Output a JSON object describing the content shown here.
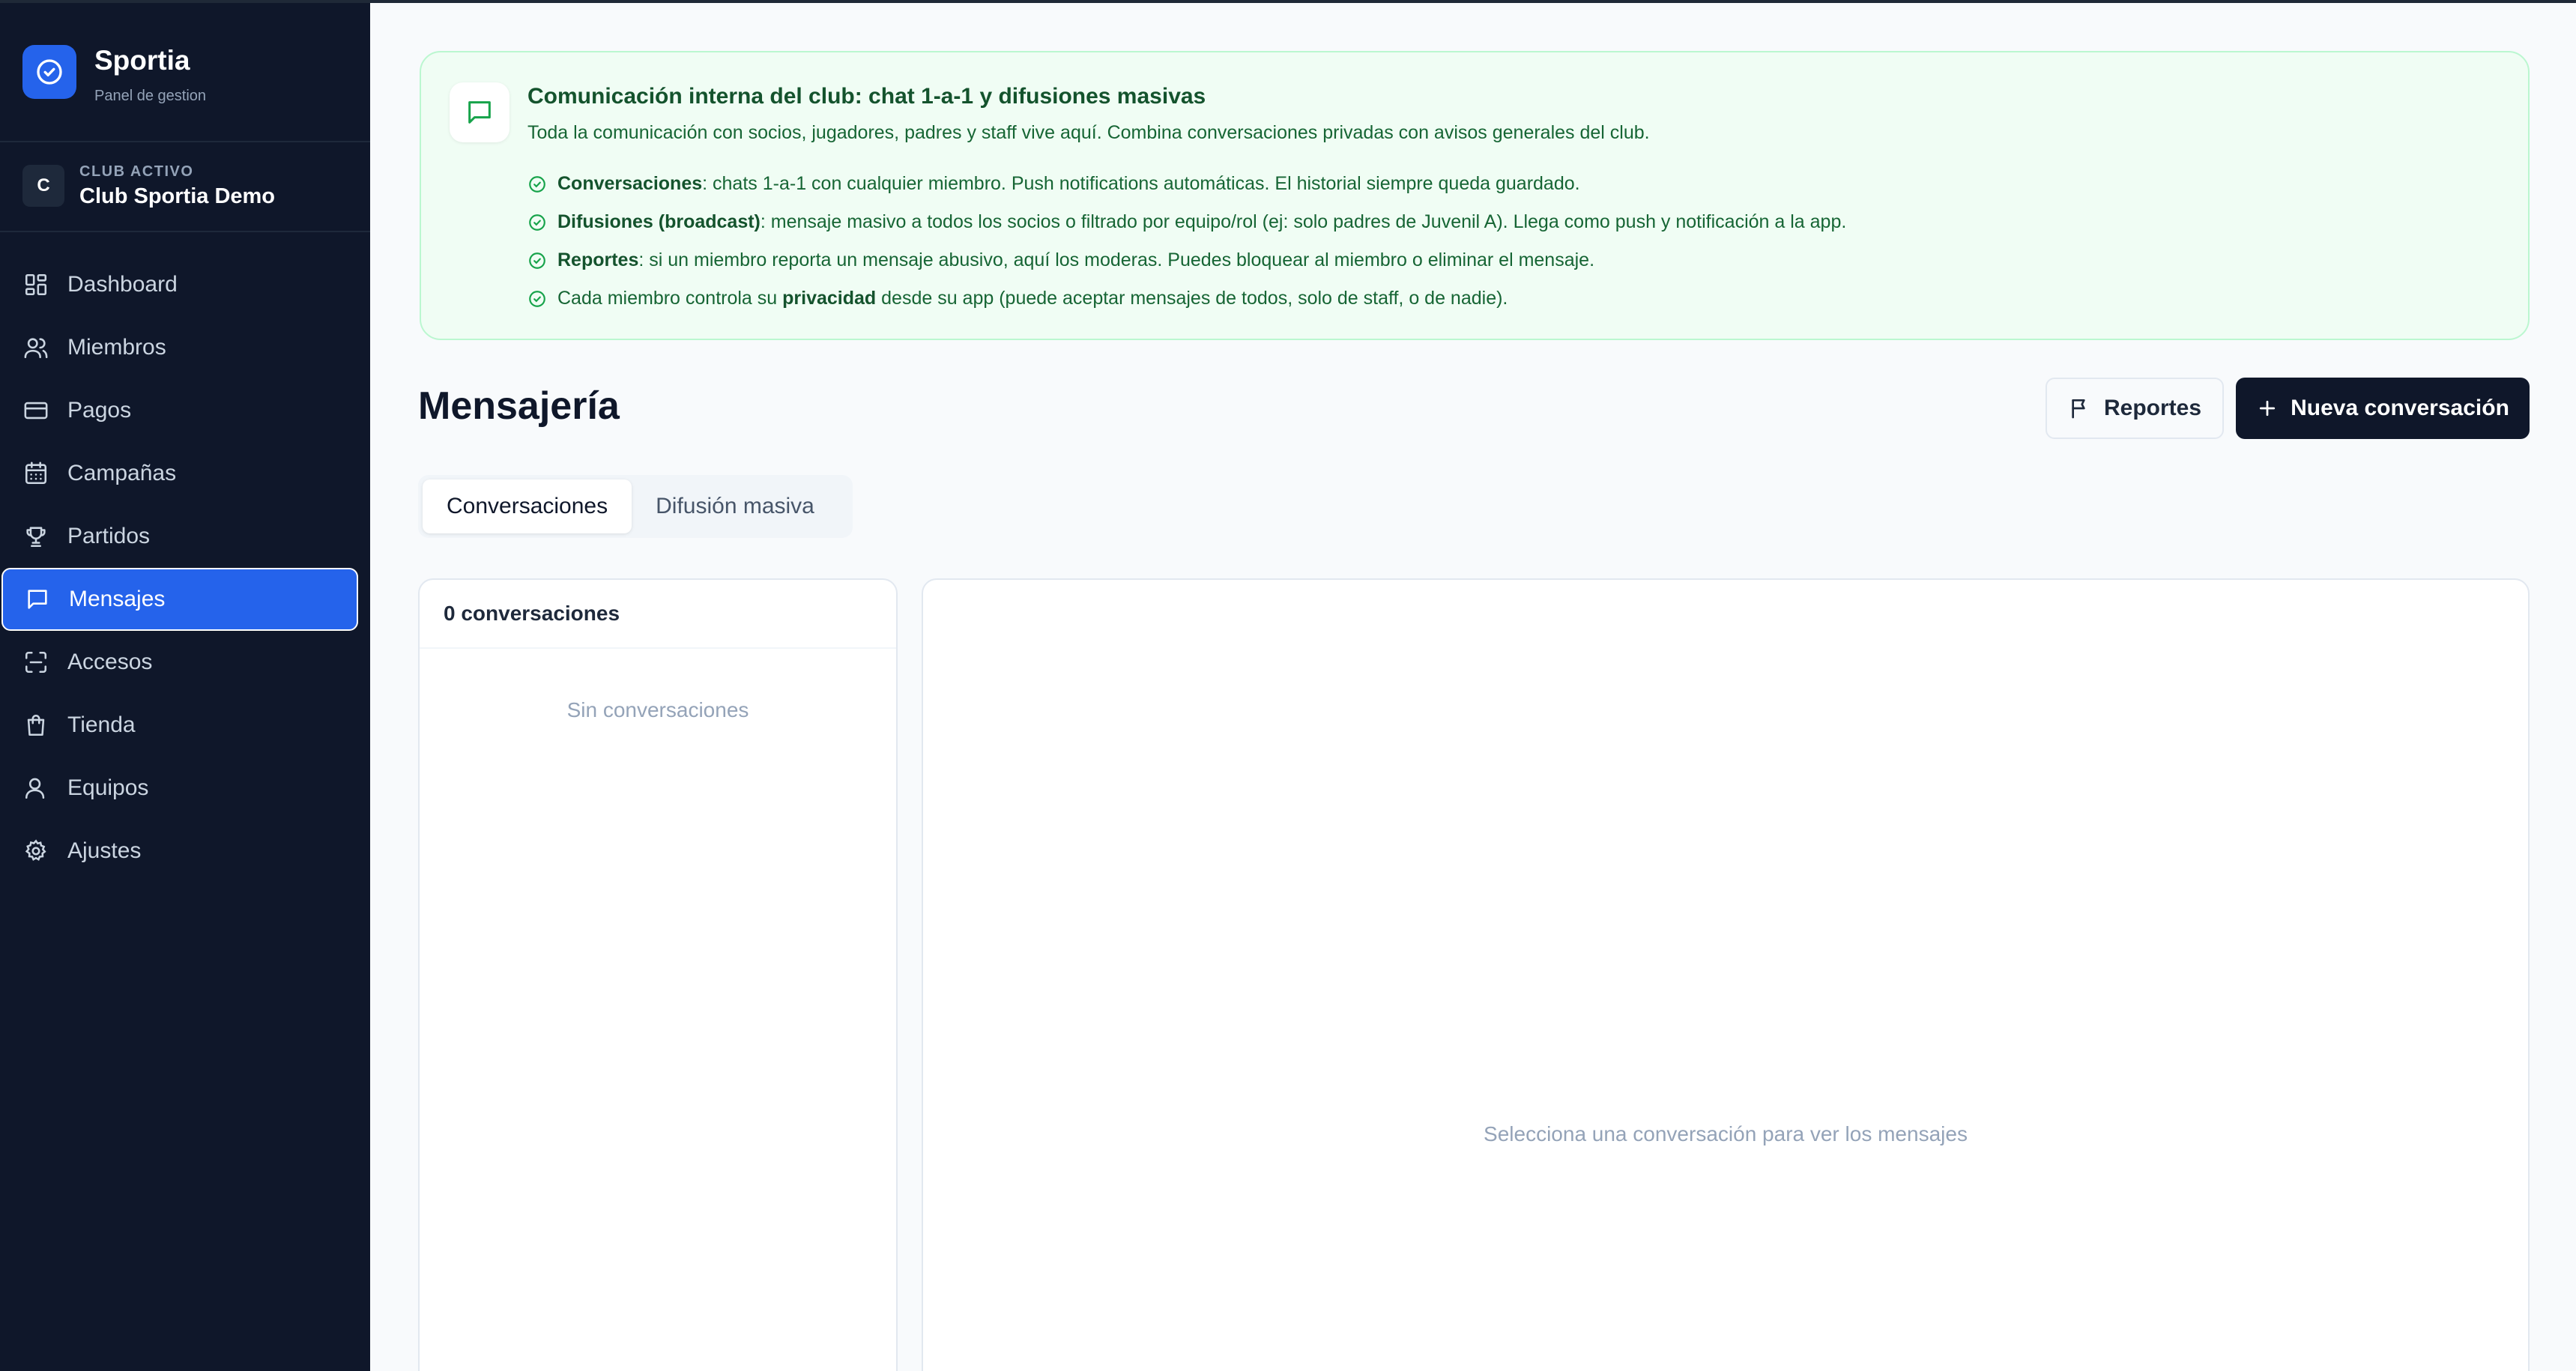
{
  "brand": {
    "name": "Sportia",
    "subtitle": "Panel de gestion"
  },
  "club": {
    "avatar_letter": "C",
    "label": "CLUB ACTIVO",
    "name": "Club Sportia Demo"
  },
  "nav": {
    "items": [
      {
        "label": "Dashboard",
        "icon": "dashboard-icon"
      },
      {
        "label": "Miembros",
        "icon": "users-icon"
      },
      {
        "label": "Pagos",
        "icon": "credit-card-icon"
      },
      {
        "label": "Campañas",
        "icon": "calendar-icon"
      },
      {
        "label": "Partidos",
        "icon": "trophy-icon"
      },
      {
        "label": "Mensajes",
        "icon": "message-icon",
        "active": true
      },
      {
        "label": "Accesos",
        "icon": "scan-icon"
      },
      {
        "label": "Tienda",
        "icon": "shopping-bag-icon"
      },
      {
        "label": "Equipos",
        "icon": "user-icon"
      },
      {
        "label": "Ajustes",
        "icon": "gear-icon"
      }
    ]
  },
  "info": {
    "title": "Comunicación interna del club: chat 1-a-1 y difusiones masivas",
    "description": "Toda la comunicación con socios, jugadores, padres y staff vive aquí. Combina conversaciones privadas con avisos generales del club.",
    "items": [
      {
        "bold": "Conversaciones",
        "pre": "",
        "text": ": chats 1-a-1 con cualquier miembro. Push notifications automáticas. El historial siempre queda guardado."
      },
      {
        "bold": "Difusiones (broadcast)",
        "pre": "",
        "text": ": mensaje masivo a todos los socios o filtrado por equipo/rol (ej: solo padres de Juvenil A). Llega como push y notificación a la app."
      },
      {
        "bold": "Reportes",
        "pre": "",
        "text": ": si un miembro reporta un mensaje abusivo, aquí los moderas. Puedes bloquear al miembro o eliminar el mensaje."
      },
      {
        "bold": "privacidad",
        "pre": "Cada miembro controla su ",
        "text": " desde su app (puede aceptar mensajes de todos, solo de staff, o de nadie)."
      }
    ]
  },
  "page": {
    "title": "Mensajería"
  },
  "actions": {
    "reports_label": "Reportes",
    "new_label": "Nueva conversación"
  },
  "tabs": [
    {
      "label": "Conversaciones",
      "active": true
    },
    {
      "label": "Difusión masiva",
      "active": false
    }
  ],
  "conversations": {
    "count_label": "0 conversaciones",
    "empty_label": "Sin conversaciones"
  },
  "chat": {
    "empty_label": "Selecciona una conversación para ver los mensajes"
  },
  "colors": {
    "accent": "#2563eb",
    "sidebar_bg": "#0f172a",
    "info_bg": "#f0fdf4",
    "info_text": "#166534"
  }
}
